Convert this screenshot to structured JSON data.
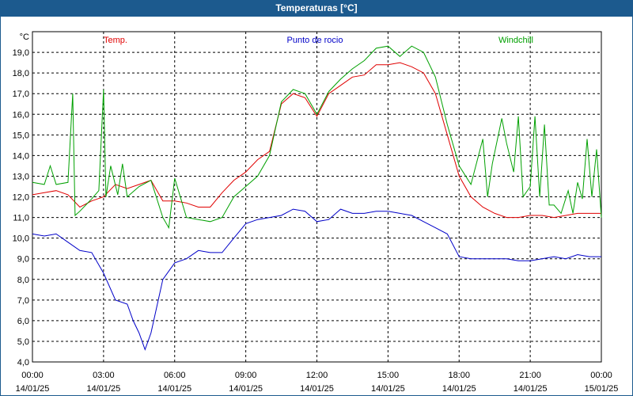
{
  "window": {
    "title": "Temperaturas [°C]"
  },
  "chart_data": {
    "type": "line",
    "title": "Temperaturas [°C]",
    "ylabel": "°C",
    "xlabel": "",
    "ylim": [
      4.0,
      20.0
    ],
    "xlim": [
      0,
      24
    ],
    "grid": true,
    "legend_position": "top",
    "y_ticks": [
      "4,0",
      "5,0",
      "6,0",
      "7,0",
      "8,0",
      "9,0",
      "10,0",
      "11,0",
      "12,0",
      "13,0",
      "14,0",
      "15,0",
      "16,0",
      "17,0",
      "18,0",
      "19,0"
    ],
    "x_ticks": [
      {
        "time": "00:00",
        "date": "14/01/25"
      },
      {
        "time": "03:00",
        "date": "14/01/25"
      },
      {
        "time": "06:00",
        "date": "14/01/25"
      },
      {
        "time": "09:00",
        "date": "14/01/25"
      },
      {
        "time": "12:00",
        "date": "14/01/25"
      },
      {
        "time": "15:00",
        "date": "14/01/25"
      },
      {
        "time": "18:00",
        "date": "14/01/25"
      },
      {
        "time": "21:00",
        "date": "14/01/25"
      },
      {
        "time": "00:00",
        "date": "15/01/25"
      }
    ],
    "series": [
      {
        "name": "Temp.",
        "color": "#e00000",
        "x": [
          0,
          0.5,
          1,
          1.5,
          2,
          2.5,
          3,
          3.5,
          4,
          4.5,
          5,
          5.5,
          6,
          6.5,
          7,
          7.5,
          8,
          8.5,
          9,
          9.5,
          10,
          10.5,
          11,
          11.5,
          12,
          12.5,
          13,
          13.5,
          14,
          14.5,
          15,
          15.5,
          16,
          16.5,
          17,
          17.5,
          18,
          18.5,
          19,
          19.5,
          20,
          20.5,
          21,
          21.5,
          22,
          22.5,
          23,
          23.5,
          24
        ],
        "values": [
          12.1,
          12.2,
          12.3,
          12.1,
          11.5,
          11.8,
          12.0,
          12.6,
          12.4,
          12.6,
          12.8,
          11.8,
          11.8,
          11.7,
          11.5,
          11.5,
          12.2,
          12.8,
          13.2,
          13.8,
          14.2,
          16.5,
          17.0,
          16.8,
          15.9,
          17.0,
          17.4,
          17.8,
          17.9,
          18.4,
          18.4,
          18.5,
          18.3,
          18.0,
          17.0,
          15.0,
          13.0,
          12.0,
          11.5,
          11.2,
          11.0,
          11.0,
          11.1,
          11.1,
          11.0,
          11.1,
          11.2,
          11.2,
          11.2
        ]
      },
      {
        "name": "Punto de rocio",
        "color": "#0000c8",
        "x": [
          0,
          0.5,
          1,
          1.5,
          2,
          2.5,
          3,
          3.5,
          4,
          4.25,
          4.5,
          4.75,
          5,
          5.5,
          6,
          6.5,
          7,
          7.5,
          8,
          8.5,
          9,
          9.5,
          10,
          10.5,
          11,
          11.5,
          12,
          12.5,
          13,
          13.5,
          14,
          14.5,
          15,
          15.5,
          16,
          16.5,
          17,
          17.5,
          18,
          18.5,
          19,
          19.5,
          20,
          20.5,
          21,
          21.5,
          22,
          22.5,
          23,
          23.5,
          24
        ],
        "values": [
          10.2,
          10.1,
          10.2,
          9.8,
          9.4,
          9.3,
          8.3,
          7.0,
          6.8,
          6.0,
          5.4,
          4.6,
          5.4,
          8.0,
          8.8,
          9.0,
          9.4,
          9.3,
          9.3,
          10.0,
          10.7,
          10.9,
          11.0,
          11.1,
          11.4,
          11.3,
          10.8,
          10.9,
          11.4,
          11.2,
          11.2,
          11.3,
          11.3,
          11.2,
          11.1,
          10.8,
          10.5,
          10.2,
          9.1,
          9.0,
          9.0,
          9.0,
          9.0,
          8.9,
          8.9,
          9.0,
          9.1,
          9.0,
          9.2,
          9.1,
          9.1
        ]
      },
      {
        "name": "Windchill",
        "color": "#00a000",
        "x": [
          0,
          0.5,
          0.75,
          1,
          1.5,
          1.7,
          1.8,
          2.0,
          2.5,
          2.8,
          3.0,
          3.1,
          3.3,
          3.6,
          3.8,
          4.0,
          4.5,
          5.0,
          5.5,
          5.75,
          6.0,
          6.5,
          7.0,
          7.5,
          8.0,
          8.5,
          9.0,
          9.5,
          10.0,
          10.5,
          11.0,
          11.5,
          12.0,
          12.5,
          13.0,
          13.5,
          14.0,
          14.5,
          15.0,
          15.5,
          16.0,
          16.5,
          17.0,
          17.5,
          18.0,
          18.5,
          19.0,
          19.2,
          19.4,
          19.8,
          20.0,
          20.3,
          20.5,
          20.7,
          21.0,
          21.2,
          21.4,
          21.6,
          21.8,
          22.0,
          22.3,
          22.6,
          22.8,
          23.0,
          23.2,
          23.4,
          23.6,
          23.8,
          24.0
        ],
        "values": [
          12.7,
          12.6,
          13.5,
          12.6,
          12.7,
          17.0,
          11.1,
          11.3,
          11.9,
          12.3,
          17.2,
          12.0,
          13.5,
          12.1,
          13.6,
          12.0,
          12.5,
          12.8,
          11.0,
          10.5,
          12.9,
          11.0,
          10.9,
          10.8,
          11.0,
          12.0,
          12.5,
          13.0,
          14.0,
          16.6,
          17.2,
          17.0,
          16.0,
          17.1,
          17.7,
          18.2,
          18.6,
          19.2,
          19.3,
          18.8,
          19.3,
          19.0,
          17.8,
          15.5,
          13.5,
          12.6,
          14.8,
          12.0,
          13.6,
          15.8,
          14.6,
          13.2,
          15.9,
          12.0,
          12.5,
          15.9,
          12.0,
          15.5,
          11.6,
          11.6,
          11.2,
          12.3,
          11.2,
          12.7,
          11.9,
          14.8,
          12.0,
          14.3,
          11.0
        ]
      }
    ]
  }
}
